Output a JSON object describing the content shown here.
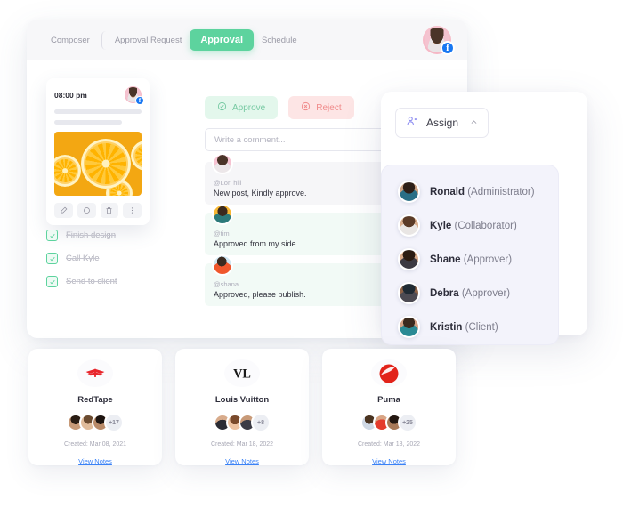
{
  "app": {
    "tabs": [
      {
        "label": "Composer",
        "active": false
      },
      {
        "label": "Approval Request",
        "active": false
      },
      {
        "label": "Approval",
        "active": true
      },
      {
        "label": "Schedule",
        "active": false
      }
    ],
    "account_badge": "f"
  },
  "post": {
    "time": "08:00 pm",
    "badge": "f",
    "actions": [
      "edit-icon",
      "comment-icon",
      "delete-icon",
      "more-icon"
    ]
  },
  "checklist": [
    {
      "label": "Finish design",
      "checked": true
    },
    {
      "label": "Call Kyle",
      "checked": true
    },
    {
      "label": "Send to client",
      "checked": true
    }
  ],
  "review": {
    "approve_label": "Approve",
    "reject_label": "Reject"
  },
  "comment_box": {
    "placeholder": "Write a comment...",
    "value": ""
  },
  "comments": [
    {
      "user": "@Lori hill",
      "text": "New post, Kindly approve.",
      "tone": "gray"
    },
    {
      "user": "@tim",
      "text": "Approved from my side.",
      "tone": "green"
    },
    {
      "user": "@shana",
      "text": "Approved, please publish.",
      "tone": "green"
    }
  ],
  "assign": {
    "button_label": "Assign",
    "members": [
      {
        "name": "Ronald",
        "role": "(Administrator)"
      },
      {
        "name": "Kyle",
        "role": "(Collaborator)"
      },
      {
        "name": "Shane",
        "role": "(Approver)"
      },
      {
        "name": "Debra",
        "role": "(Approver)"
      },
      {
        "name": "Kristin",
        "role": "(Client)"
      }
    ]
  },
  "brands": [
    {
      "name": "RedTape",
      "logo": "redtape-logo",
      "extra_count": "+17",
      "created": "Created: Mar 08, 2021",
      "link": "View Notes"
    },
    {
      "name": "Louis Vuitton",
      "logo": "louis-vuitton-logo",
      "extra_count": "+8",
      "created": "Created: Mar 18, 2022",
      "link": "View Notes"
    },
    {
      "name": "Puma",
      "logo": "puma-logo",
      "extra_count": "+25",
      "created": "Created: Mar 18, 2022",
      "link": "View Notes"
    }
  ],
  "colors": {
    "accent_green": "#5dd39e",
    "reject_red": "#f08a8a",
    "link_blue": "#3b82f6",
    "facebook_blue": "#1877f2",
    "panel_lavender": "#f3f3fb"
  }
}
